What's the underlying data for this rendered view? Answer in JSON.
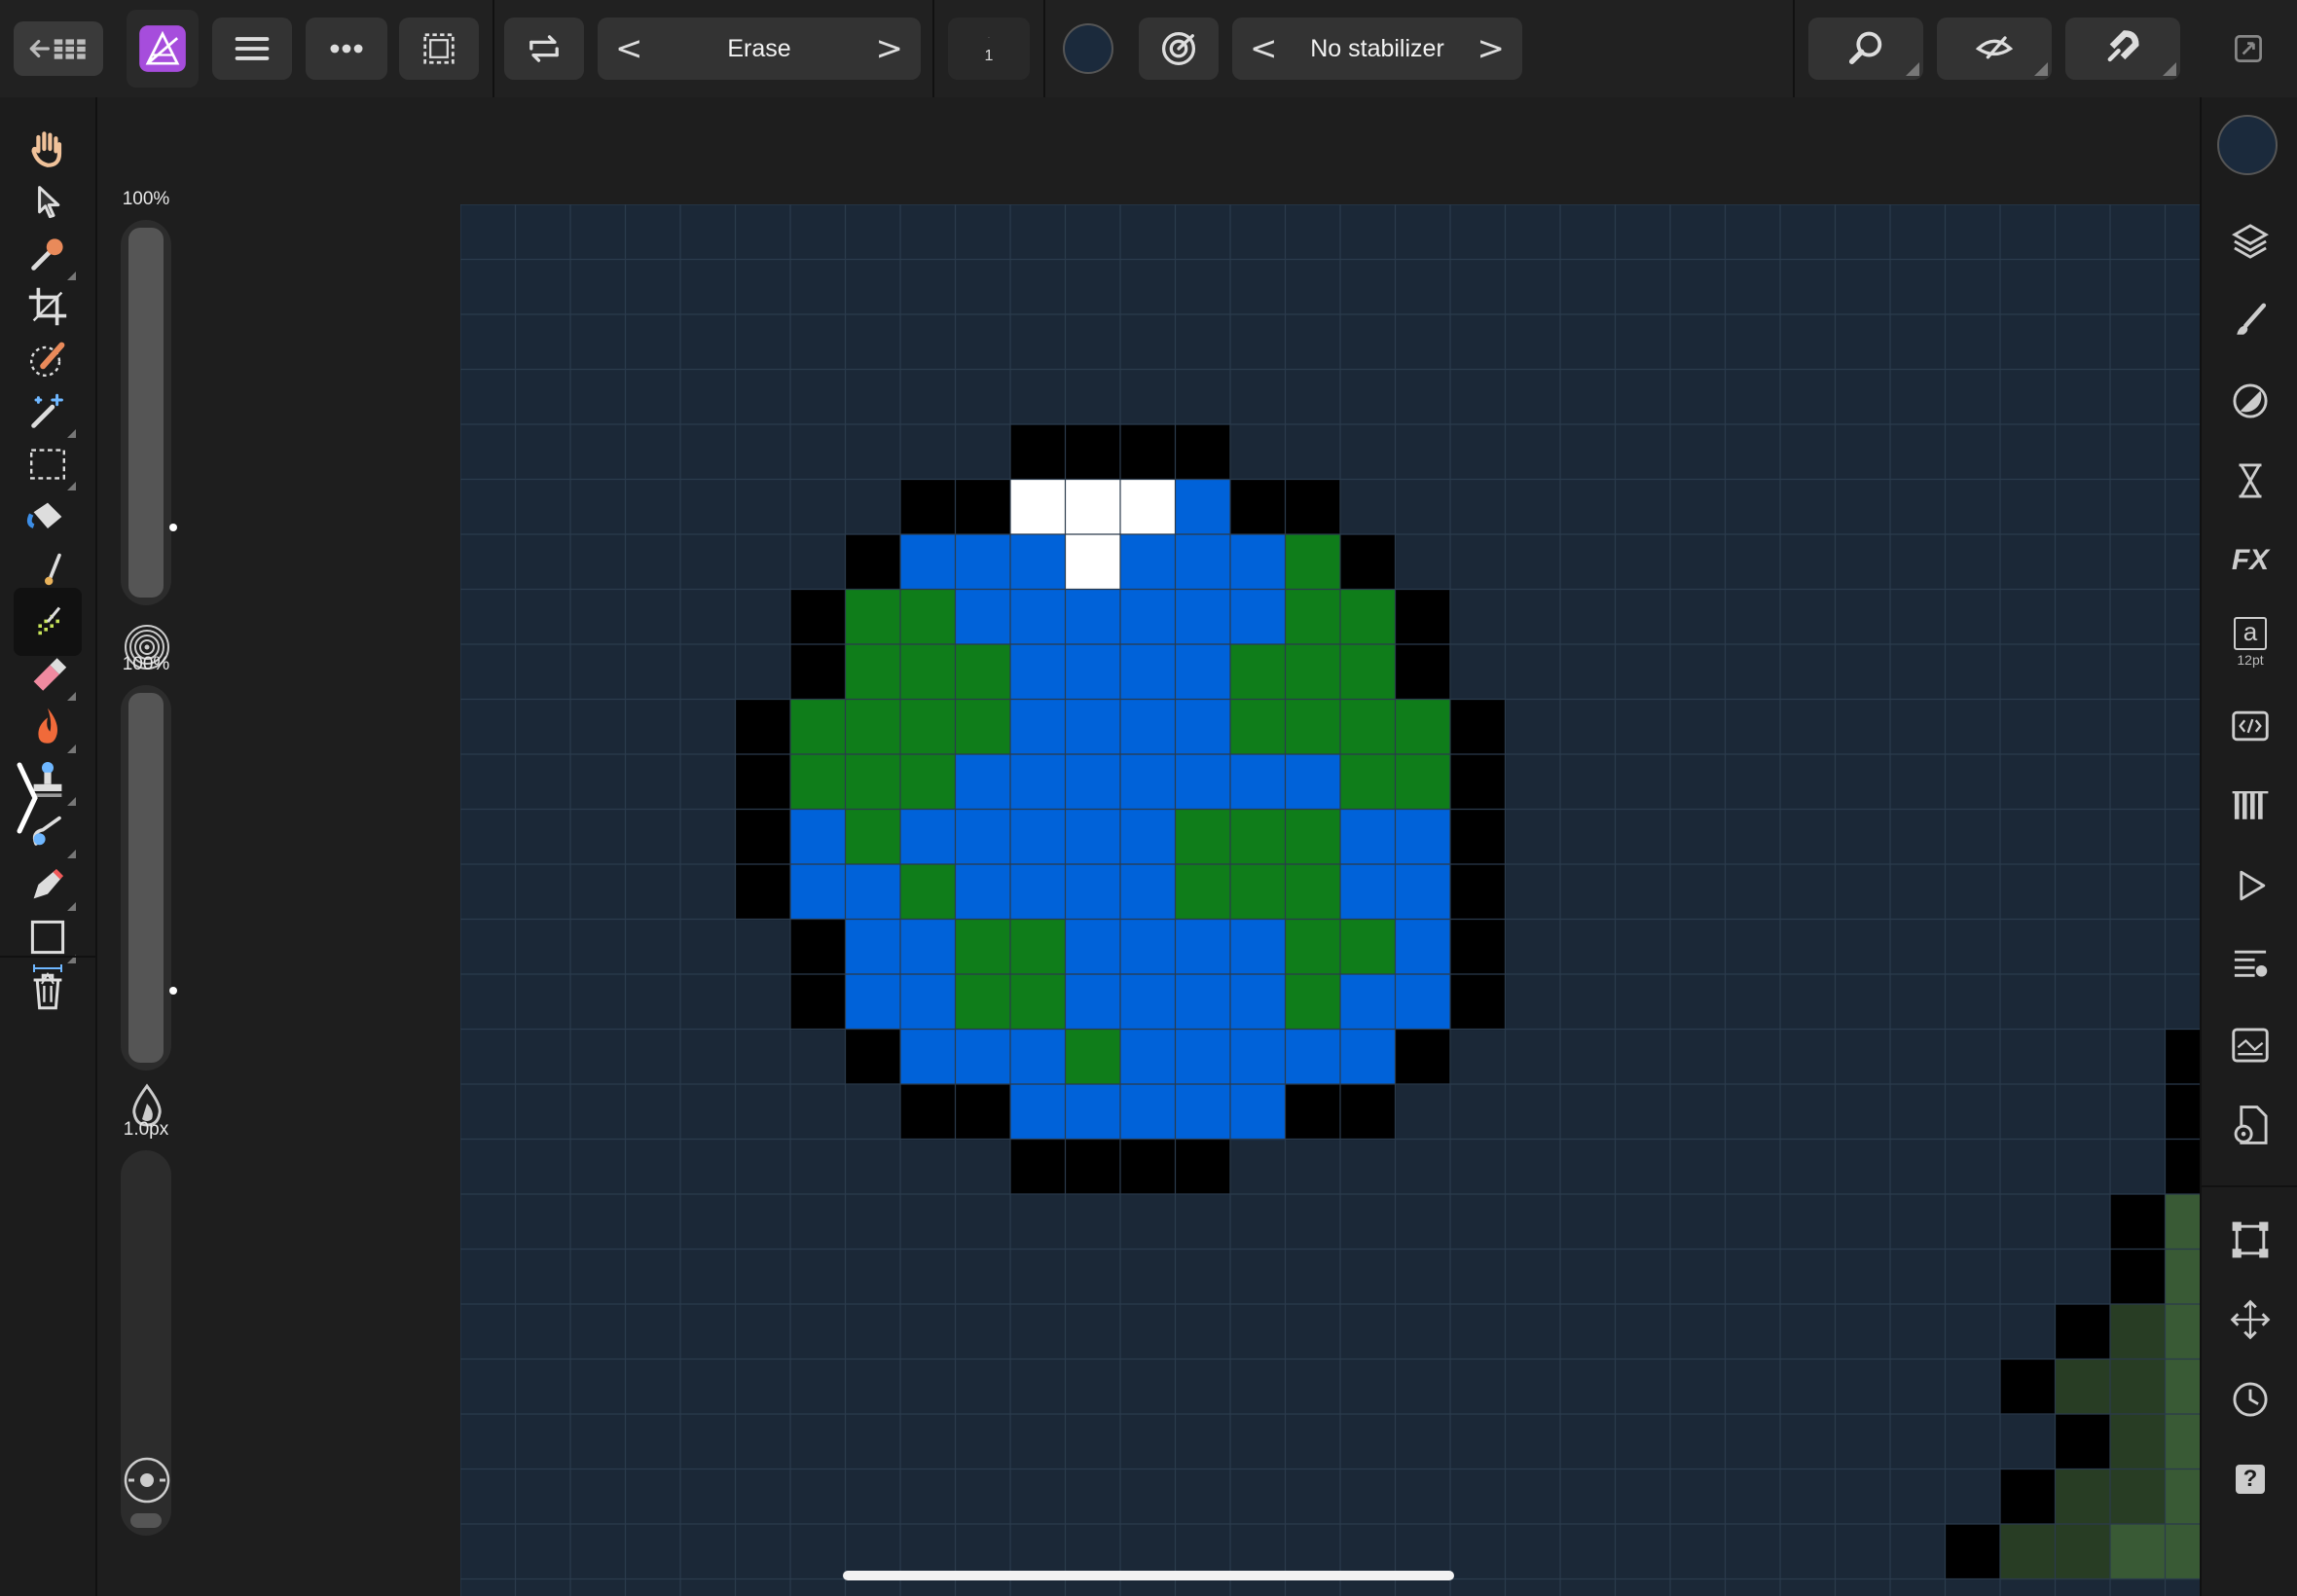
{
  "topbar": {
    "brush_mode_label": "Erase",
    "brush_mode_prev": "<",
    "brush_mode_next": ">",
    "size_value": "1",
    "stabilizer_label": "No stabilizer",
    "stabilizer_prev": "<",
    "stabilizer_next": ">",
    "current_color": "#1b2a3c"
  },
  "tools": [
    {
      "name": "hand-tool",
      "icon": "hand-icon"
    },
    {
      "name": "move-tool",
      "icon": "arrow-pointer-icon"
    },
    {
      "name": "color-picker-tool",
      "icon": "eyedropper-icon"
    },
    {
      "name": "crop-tool",
      "icon": "crop-icon"
    },
    {
      "name": "selection-brush-tool",
      "icon": "selection-brush-icon"
    },
    {
      "name": "magic-wand-tool",
      "icon": "magic-wand-icon"
    },
    {
      "name": "rectangle-marquee-tool",
      "icon": "marquee-icon"
    },
    {
      "name": "flood-fill-tool",
      "icon": "paint-bucket-icon"
    },
    {
      "name": "paint-brush-tool",
      "icon": "paint-brush-icon"
    },
    {
      "name": "pixel-tool",
      "icon": "pixel-icon"
    },
    {
      "name": "erase-brush-tool",
      "icon": "eraser-icon"
    },
    {
      "name": "dodge-burn-tool",
      "icon": "flame-icon"
    },
    {
      "name": "clone-tool",
      "icon": "stamp-icon"
    },
    {
      "name": "smudge-tool",
      "icon": "smudge-icon"
    },
    {
      "name": "pen-tool",
      "icon": "pen-icon"
    },
    {
      "name": "shape-tool",
      "icon": "rectangle-icon"
    },
    {
      "name": "text-tool",
      "icon": "text-frame-icon"
    }
  ],
  "context": {
    "opacity_label": "100%",
    "opacity_value": 1.0,
    "flow_label": "100%",
    "flow_value": 1.0,
    "width_label": "1.0px",
    "width_value": 0.04
  },
  "right_studios": [
    {
      "name": "color-swatch",
      "icon": "color-circle-icon"
    },
    {
      "name": "layers-studio",
      "icon": "layers-icon"
    },
    {
      "name": "brushes-studio",
      "icon": "brush-icon"
    },
    {
      "name": "adjustments-studio",
      "icon": "adjustment-icon"
    },
    {
      "name": "history-studio",
      "icon": "hourglass-icon"
    },
    {
      "name": "fx-studio",
      "icon": "fx-icon",
      "text": "FX"
    },
    {
      "name": "text-styles-studio",
      "icon": "text-style-icon",
      "text": "a",
      "subtext": "12pt"
    },
    {
      "name": "macro-studio",
      "icon": "code-icon"
    },
    {
      "name": "channels-studio",
      "icon": "channels-icon"
    },
    {
      "name": "play-studio",
      "icon": "play-icon"
    },
    {
      "name": "stock-studio",
      "icon": "list-icon"
    },
    {
      "name": "navigator-studio",
      "icon": "navigator-icon"
    },
    {
      "name": "document-settings",
      "icon": "document-gear-icon"
    },
    {
      "name": "transform-studio",
      "icon": "transform-icon"
    },
    {
      "name": "move-studio",
      "icon": "move-arrows-icon"
    },
    {
      "name": "snapshots-studio",
      "icon": "clock-icon"
    },
    {
      "name": "help-studio",
      "icon": "help-icon",
      "text": "?"
    }
  ],
  "canvas": {
    "background": "#1b2837",
    "grid_color": "#2b3b4c",
    "palette": {
      "K": "#000000",
      "W": "#ffffff",
      "B": "#0062d9",
      "G": "#0f7d1a",
      "D": "#283d24",
      "L": "#395a35"
    },
    "globe_rows": [
      ".......KKKK.......",
      ".....KKWWWBKK.....",
      "....KBBBWBBBGK....",
      "...KGGBBBBBBGGK...",
      "...KGGGBBBBGGGK...",
      "..KGGGGBBBBGGGGK..",
      "..KGGGBBBBBBBGGK..",
      "..KBGBBBBBGGGBBK..",
      "..KBBGBBBBGGGBBK..",
      "...KBBGGBBBBGGBK..",
      "...KBBGGBBBBGBBK..",
      "....KBBBGBBBBBK...",
      ".....KKBBBBBKK....",
      ".......KKKK......."
    ],
    "corner_shape": [
      {
        "col": 30,
        "row": 18,
        "c": "K"
      },
      {
        "col": 30,
        "row": 19,
        "c": "K"
      },
      {
        "col": 29,
        "row": 20,
        "c": "K"
      },
      {
        "col": 30,
        "row": 20,
        "c": "D"
      },
      {
        "col": 28,
        "row": 21,
        "c": "K"
      },
      {
        "col": 29,
        "row": 21,
        "c": "D"
      },
      {
        "col": 30,
        "row": 21,
        "c": "D"
      },
      {
        "col": 29,
        "row": 22,
        "c": "K"
      },
      {
        "col": 30,
        "row": 22,
        "c": "D"
      },
      {
        "col": 28,
        "row": 23,
        "c": "K"
      },
      {
        "col": 29,
        "row": 23,
        "c": "D"
      },
      {
        "col": 30,
        "row": 23,
        "c": "D"
      },
      {
        "col": 27,
        "row": 24,
        "c": "K"
      },
      {
        "col": 28,
        "row": 24,
        "c": "D"
      },
      {
        "col": 29,
        "row": 24,
        "c": "D"
      },
      {
        "col": 30,
        "row": 24,
        "c": "L"
      },
      {
        "col": 31,
        "row": 15,
        "c": "K"
      },
      {
        "col": 31,
        "row": 16,
        "c": "K"
      },
      {
        "col": 31,
        "row": 17,
        "c": "K"
      },
      {
        "col": 31,
        "row": 18,
        "c": "L"
      },
      {
        "col": 31,
        "row": 19,
        "c": "L"
      },
      {
        "col": 31,
        "row": 20,
        "c": "L"
      },
      {
        "col": 31,
        "row": 21,
        "c": "L"
      },
      {
        "col": 31,
        "row": 22,
        "c": "L"
      },
      {
        "col": 31,
        "row": 23,
        "c": "L"
      },
      {
        "col": 31,
        "row": 24,
        "c": "L"
      }
    ]
  }
}
